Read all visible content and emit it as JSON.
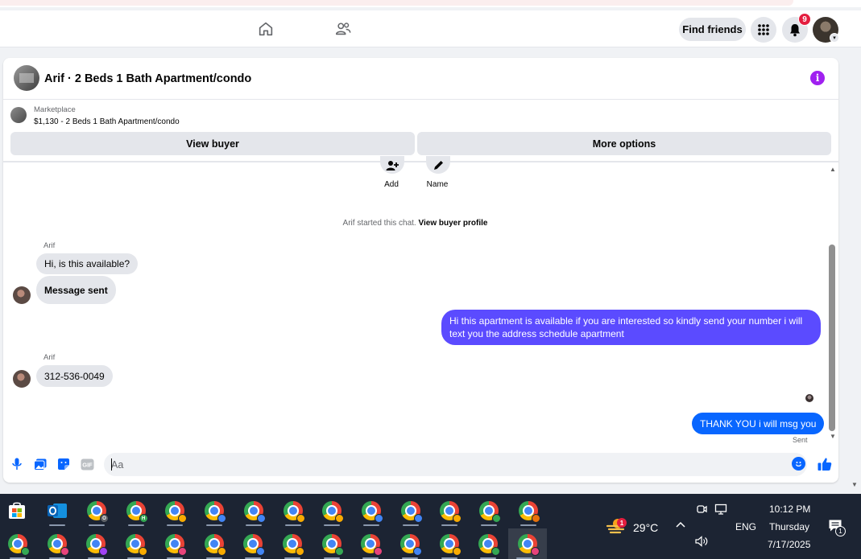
{
  "header": {
    "find_friends_label": "Find friends",
    "notification_count": "9"
  },
  "chat": {
    "title": "Arif · 2 Beds 1 Bath Apartment/condo",
    "marketplace_label": "Marketplace",
    "listing": "$1,130 - 2 Beds 1 Bath Apartment/condo",
    "view_buyer_label": "View buyer",
    "more_options_label": "More options",
    "top_actions": [
      {
        "label": "Add"
      },
      {
        "label": "Name"
      }
    ],
    "started_text": "Arif started this chat.",
    "started_link": "View buyer profile",
    "messages": [
      {
        "sender": "Arif",
        "text": "Hi, is this available?"
      },
      {
        "text": "Message sent"
      },
      {
        "text": "Hi this apartment is available if you are interested so kindly send your number i will text you the address schedule apartment"
      },
      {
        "sender": "Arif",
        "text": "312-536-0049"
      },
      {
        "text": "THANK YOU i will msg you"
      }
    ],
    "sent_status": "Sent",
    "composer_placeholder": "Aa"
  },
  "colors": {
    "outgoing_purple": "#5b4bff",
    "outgoing_blue": "#0866ff",
    "info_purple": "#a020f0",
    "badge_red": "#e41e3f"
  },
  "taskbar": {
    "weather_temp": "29°C",
    "weather_badge": "1",
    "language": "ENG",
    "time": "10:12 PM",
    "day": "Thursday",
    "date": "7/17/2025",
    "notification_badge": "1",
    "chrome_profile_row1": [
      "O",
      "H",
      "",
      "",
      "",
      "",
      "",
      "",
      "",
      "",
      "",
      ""
    ],
    "chrome_profile_row2": [
      "",
      "",
      "",
      "",
      "",
      "",
      "",
      "",
      "",
      "",
      "",
      "",
      "",
      ""
    ]
  }
}
